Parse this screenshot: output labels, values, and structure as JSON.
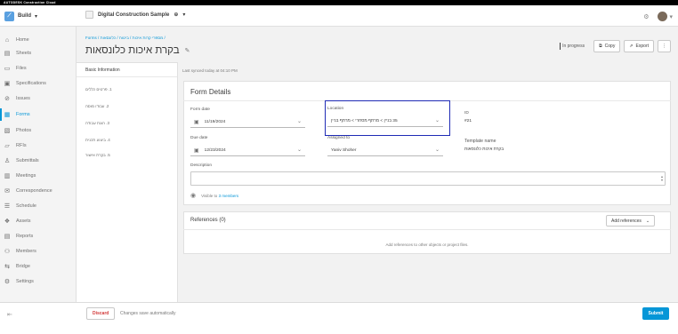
{
  "topbar": {
    "brand": "AUTODESK Construction Cloud"
  },
  "header": {
    "module": "Build",
    "project": "Digital Construction Sample"
  },
  "sidebar": {
    "items": [
      {
        "label": "Home",
        "icon": "home-icon"
      },
      {
        "label": "Sheets",
        "icon": "sheets-icon"
      },
      {
        "label": "Files",
        "icon": "files-icon"
      },
      {
        "label": "Specifications",
        "icon": "specifications-icon"
      },
      {
        "label": "Issues",
        "icon": "issues-icon"
      },
      {
        "label": "Forms",
        "icon": "forms-icon",
        "active": true
      },
      {
        "label": "Photos",
        "icon": "photos-icon"
      },
      {
        "label": "RFIs",
        "icon": "rfis-icon"
      },
      {
        "label": "Submittals",
        "icon": "submittals-icon"
      },
      {
        "label": "Meetings",
        "icon": "meetings-icon"
      },
      {
        "label": "Correspondence",
        "icon": "correspondence-icon"
      },
      {
        "label": "Schedule",
        "icon": "schedule-icon"
      },
      {
        "label": "Assets",
        "icon": "assets-icon"
      },
      {
        "label": "Reports",
        "icon": "reports-icon"
      },
      {
        "label": "Members",
        "icon": "members-icon"
      },
      {
        "label": "Bridge",
        "icon": "bridge-icon"
      },
      {
        "label": "Settings",
        "icon": "settings-icon"
      }
    ],
    "accent": "#0696d7"
  },
  "breadcrumb": "Forms / מספרי קרות איכות / ביטוח / כלונסאות /",
  "page": {
    "title": "בקרת איכות כלונסאות",
    "status": "In progress",
    "copy_label": "Copy",
    "export_label": "Export"
  },
  "left_panel": {
    "heading": "Basic Information",
    "items": [
      "1. פרטים כללים",
      "2. עבודו מוסה",
      "3. הוגת עבודה",
      "4. ביצוע תכנית",
      "5. בקרת אישור"
    ]
  },
  "synced": "Last synced today at 04:10 PM",
  "form_details": {
    "title": "Form Details",
    "form_date_label": "Form date",
    "form_date_value": "11/19/2024",
    "due_date_label": "Due date",
    "due_date_value": "12/23/2024",
    "location_label": "Location",
    "location_value": "35 בניין > מרתף מסחרי > מרתף בניין",
    "assigned_label": "Assigned to",
    "assigned_value": "Yaniv Shoher",
    "id_label": "ID",
    "id_value": "#21",
    "template_label": "Template name",
    "template_value": "בקרת איכות כלונסאות",
    "description_label": "Description",
    "visible_prefix": "Visible to",
    "visible_link": "3 members"
  },
  "references": {
    "title": "References (0)",
    "add_label": "Add references",
    "empty": "Add references to other objects or project files."
  },
  "footer": {
    "discard": "Discard",
    "autosave": "Changes save automatically",
    "submit": "Submit"
  }
}
